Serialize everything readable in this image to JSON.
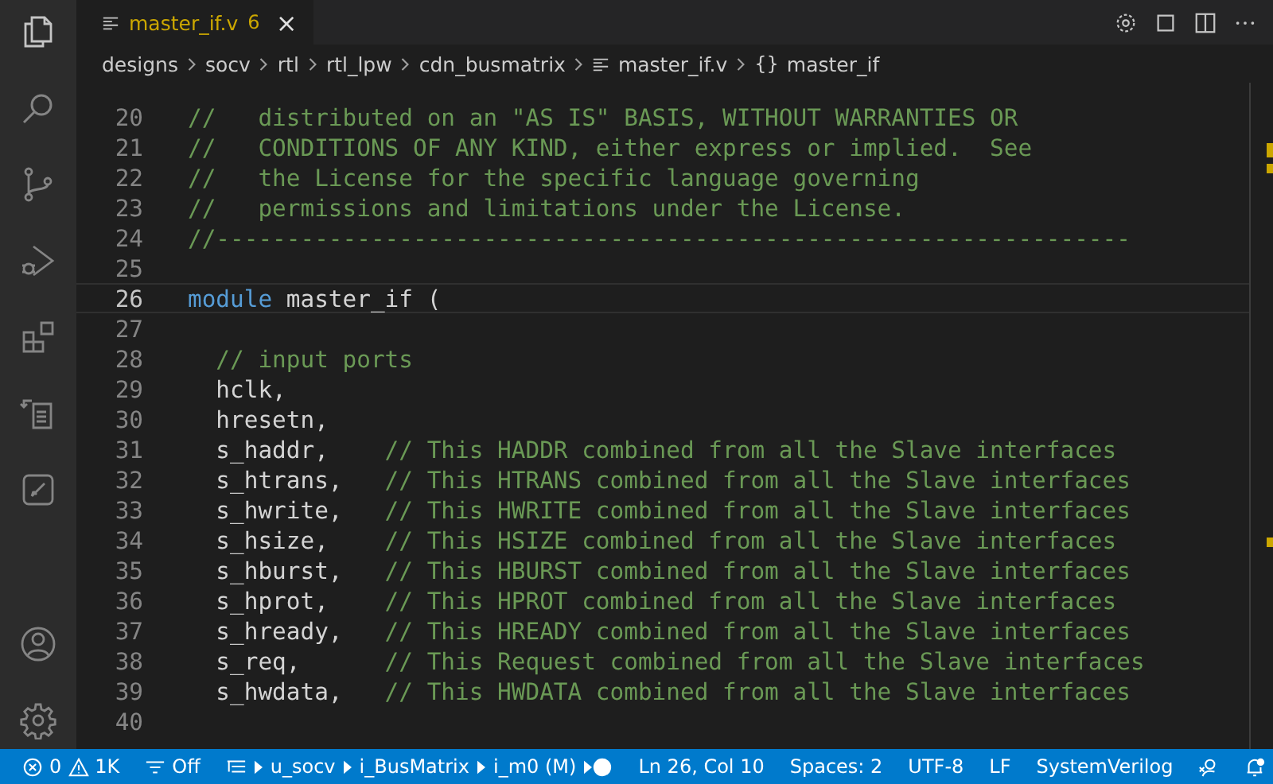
{
  "tab": {
    "title": "master_if.v",
    "problems": "6",
    "close": "×",
    "selected": true
  },
  "breadcrumbs": [
    {
      "kind": "folder",
      "label": "designs"
    },
    {
      "kind": "folder",
      "label": "socv"
    },
    {
      "kind": "folder",
      "label": "rtl"
    },
    {
      "kind": "folder",
      "label": "rtl_lpw"
    },
    {
      "kind": "folder",
      "label": "cdn_busmatrix"
    },
    {
      "kind": "file",
      "label": "master_if.v"
    },
    {
      "kind": "symbol",
      "icon": "{}",
      "label": "master_if"
    }
  ],
  "lines": [
    {
      "n": "20",
      "current": false,
      "tokens": [
        {
          "kind": "comment",
          "text": "//   distributed on an \"AS IS\" BASIS, WITHOUT WARRANTIES OR"
        }
      ]
    },
    {
      "n": "21",
      "current": false,
      "tokens": [
        {
          "kind": "comment",
          "text": "//   CONDITIONS OF ANY KIND, either express or implied.  See"
        }
      ]
    },
    {
      "n": "22",
      "current": false,
      "tokens": [
        {
          "kind": "comment",
          "text": "//   the License for the specific language governing"
        }
      ]
    },
    {
      "n": "23",
      "current": false,
      "tokens": [
        {
          "kind": "comment",
          "text": "//   permissions and limitations under the License."
        }
      ]
    },
    {
      "n": "24",
      "current": false,
      "tokens": [
        {
          "kind": "comment",
          "text": "//-----------------------------------------------------------------"
        }
      ]
    },
    {
      "n": "25",
      "current": false
    },
    {
      "n": "26",
      "current": true,
      "tokens": [
        {
          "kind": "keyword",
          "text": "module"
        },
        {
          "kind": "code",
          "text": " master_if ("
        }
      ]
    },
    {
      "n": "27",
      "current": false
    },
    {
      "n": "28",
      "current": false,
      "tokens": [
        {
          "kind": "comment",
          "text": "  // input ports"
        }
      ]
    },
    {
      "n": "29",
      "current": false,
      "tokens": [
        {
          "kind": "code",
          "text": "  hclk,"
        }
      ]
    },
    {
      "n": "30",
      "current": false,
      "tokens": [
        {
          "kind": "code",
          "text": "  hresetn,"
        }
      ]
    },
    {
      "n": "31",
      "current": false,
      "tokens": [
        {
          "kind": "code",
          "text": "  s_haddr,    "
        },
        {
          "kind": "comment",
          "text": "// This HADDR combined from all the Slave interfaces"
        }
      ]
    },
    {
      "n": "32",
      "current": false,
      "tokens": [
        {
          "kind": "code",
          "text": "  s_htrans,   "
        },
        {
          "kind": "comment",
          "text": "// This HTRANS combined from all the Slave interfaces"
        }
      ]
    },
    {
      "n": "33",
      "current": false,
      "tokens": [
        {
          "kind": "code",
          "text": "  s_hwrite,   "
        },
        {
          "kind": "comment",
          "text": "// This HWRITE combined from all the Slave interfaces"
        }
      ]
    },
    {
      "n": "34",
      "current": false,
      "tokens": [
        {
          "kind": "code",
          "text": "  s_hsize,    "
        },
        {
          "kind": "comment",
          "text": "// This HSIZE combined from all the Slave interfaces"
        }
      ]
    },
    {
      "n": "35",
      "current": false,
      "tokens": [
        {
          "kind": "code",
          "text": "  s_hburst,   "
        },
        {
          "kind": "comment",
          "text": "// This HBURST combined from all the Slave interfaces"
        }
      ]
    },
    {
      "n": "36",
      "current": false,
      "tokens": [
        {
          "kind": "code",
          "text": "  s_hprot,    "
        },
        {
          "kind": "comment",
          "text": "// This HPROT combined from all the Slave interfaces"
        }
      ]
    },
    {
      "n": "37",
      "current": false,
      "tokens": [
        {
          "kind": "code",
          "text": "  s_hready,   "
        },
        {
          "kind": "comment",
          "text": "// This HREADY combined from all the Slave interfaces"
        }
      ]
    },
    {
      "n": "38",
      "current": false,
      "tokens": [
        {
          "kind": "code",
          "text": "  s_req,      "
        },
        {
          "kind": "comment",
          "text": "// This Request combined from all the Slave interfaces"
        }
      ]
    },
    {
      "n": "39",
      "current": false,
      "tokens": [
        {
          "kind": "code",
          "text": "  s_hwdata,   "
        },
        {
          "kind": "comment",
          "text": "// This HWDATA combined from all the Slave interfaces"
        }
      ]
    },
    {
      "n": "40",
      "current": false
    }
  ],
  "status_bar": {
    "errors": "0",
    "warnings": "1K",
    "filter": "Off",
    "hierarchy": [
      "u_socv",
      "i_BusMatrix",
      "i_m0 (M)"
    ],
    "position": "Ln 26, Col 10",
    "indent": "Spaces: 2",
    "encoding": "UTF-8",
    "eol": "LF",
    "language": "SystemVerilog"
  }
}
